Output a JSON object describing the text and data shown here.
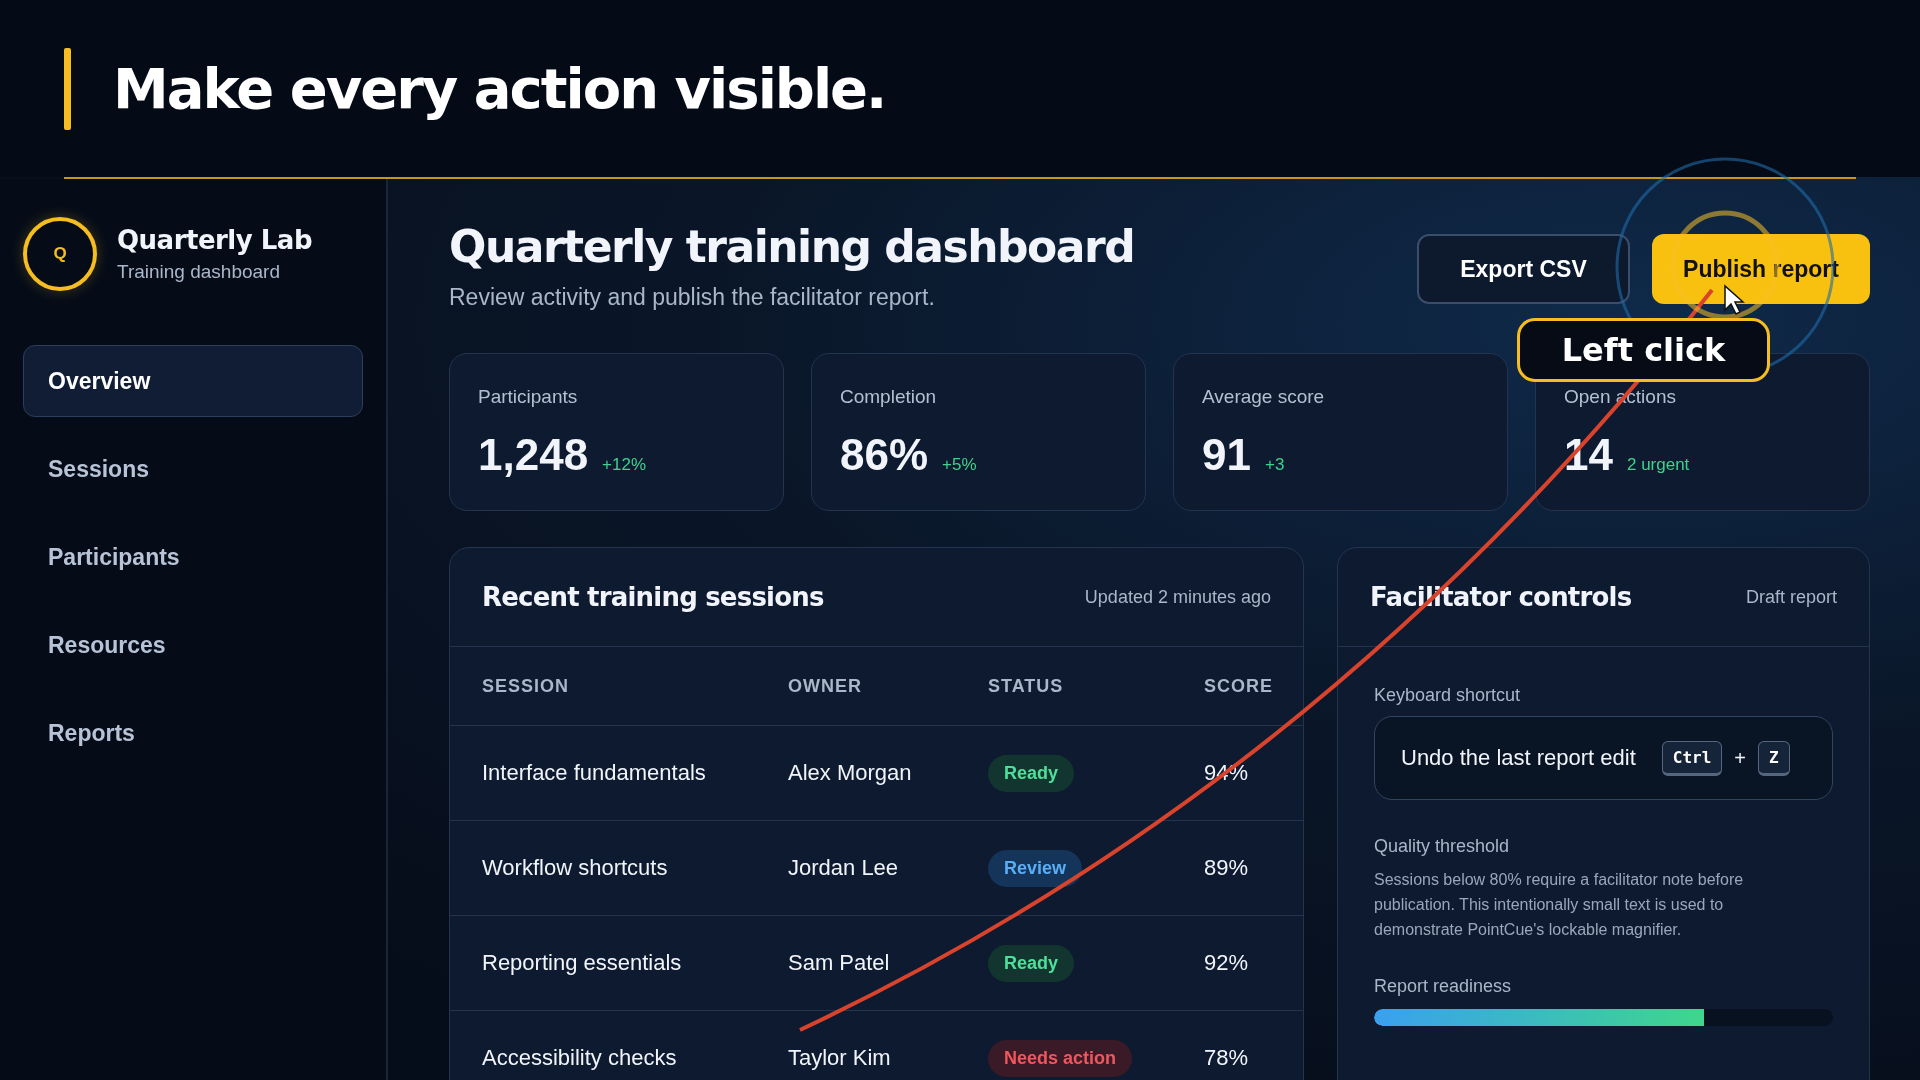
{
  "slide_title": "Make every action visible.",
  "sidebar": {
    "logo": "Q",
    "name": "Quarterly Lab",
    "subtitle": "Training dashboard",
    "items": [
      {
        "label": "Overview",
        "selected": true
      },
      {
        "label": "Sessions",
        "selected": false
      },
      {
        "label": "Participants",
        "selected": false
      },
      {
        "label": "Resources",
        "selected": false
      },
      {
        "label": "Reports",
        "selected": false
      }
    ]
  },
  "page": {
    "title": "Quarterly training dashboard",
    "subtitle": "Review activity and publish the facilitator report.",
    "buttons": [
      {
        "label": "Export CSV",
        "kind": "secondary"
      },
      {
        "label": "Publish report",
        "kind": "primary"
      }
    ]
  },
  "stats": [
    {
      "label": "Participants",
      "value": "1,248",
      "delta": "+12%"
    },
    {
      "label": "Completion",
      "value": "86%",
      "delta": "+5%"
    },
    {
      "label": "Average score",
      "value": "91",
      "delta": "+3"
    },
    {
      "label": "Open actions",
      "value": "14",
      "delta": "2 urgent"
    }
  ],
  "sessions": {
    "title": "Recent training sessions",
    "updated": "Updated 2 minutes ago",
    "columns": [
      "SESSION",
      "OWNER",
      "STATUS",
      "SCORE"
    ],
    "rows": [
      {
        "session": "Interface fundamentals",
        "owner": "Alex Morgan",
        "status": "Ready",
        "kind": "ready",
        "score": "94%"
      },
      {
        "session": "Workflow shortcuts",
        "owner": "Jordan Lee",
        "status": "Review",
        "kind": "review",
        "score": "89%"
      },
      {
        "session": "Reporting essentials",
        "owner": "Sam Patel",
        "status": "Ready",
        "kind": "ready",
        "score": "92%"
      },
      {
        "session": "Accessibility checks",
        "owner": "Taylor Kim",
        "status": "Needs action",
        "kind": "action",
        "score": "78%"
      }
    ]
  },
  "facilitator": {
    "title": "Facilitator controls",
    "tag": "Draft report",
    "shortcut_label": "Keyboard shortcut",
    "shortcut_text": "Undo the last report edit",
    "keys": [
      "Ctrl",
      "Z"
    ],
    "joiner": "+",
    "threshold_label": "Quality threshold",
    "threshold_text": "Sessions below 80% require a facilitator note before publication. This intentionally small text is used to demonstrate PointCue's lockable magnifier.",
    "readiness_label": "Report readiness",
    "level": 0.72
  },
  "callout": "Left click"
}
